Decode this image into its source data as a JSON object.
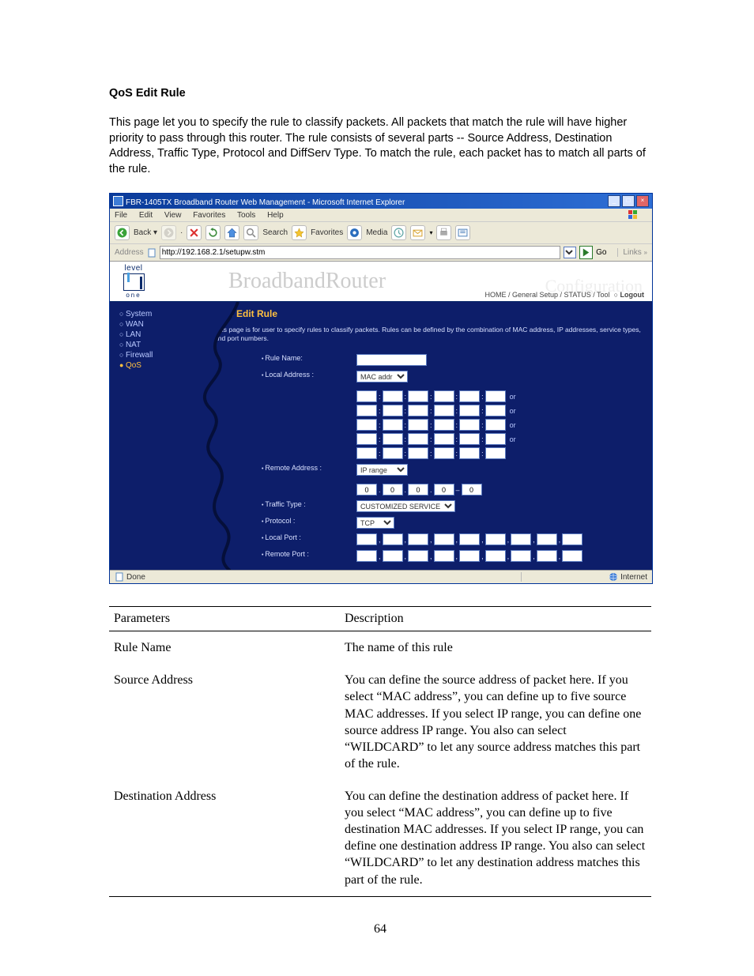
{
  "doc": {
    "heading": "QoS Edit Rule",
    "intro": "This page let you to specify the rule to classify packets. All packets that match the rule will have higher priority to pass through this router. The rule consists of several parts -- Source Address, Destination Address, Traffic Type, Protocol and DiffServ Type. To match the rule, each packet has to match all parts of the rule.",
    "page_num": "64"
  },
  "browser": {
    "title": "FBR-1405TX Broadband Router Web Management - Microsoft Internet Explorer",
    "menus": [
      "File",
      "Edit",
      "View",
      "Favorites",
      "Tools",
      "Help"
    ],
    "toolbar": {
      "back": "Back",
      "search": "Search",
      "favorites": "Favorites",
      "media": "Media"
    },
    "addr_label": "Address",
    "addr_value": "http://192.168.2.1/setupw.stm",
    "go": "Go",
    "links_label": "Links",
    "status": "Done",
    "zone": "Internet"
  },
  "page": {
    "logo_top": "level",
    "logo_bottom": "one",
    "big_title": "BroadbandRouter",
    "subtitle": "Configuration",
    "nav": {
      "home": "HOME",
      "gs": "General Setup",
      "status": "STATUS",
      "tool": "Tool",
      "logout": "Logout"
    },
    "sidebar": [
      {
        "label": "System",
        "active": false
      },
      {
        "label": "WAN",
        "active": false
      },
      {
        "label": "LAN",
        "active": false
      },
      {
        "label": "NAT",
        "active": false
      },
      {
        "label": "Firewall",
        "active": false
      },
      {
        "label": "QoS",
        "active": true
      }
    ],
    "form_title": "QoS Edit Rule",
    "form_desc": "This page is for user to specify rules to classify packets. Rules can be defined by the combination of MAC address, IP addresses, service types, and port numbers.",
    "labels": {
      "rule_name": "Rule Name:",
      "local_addr": "Local Address :",
      "remote_addr": "Remote Address :",
      "traffic_type": "Traffic Type :",
      "protocol": "Protocol :",
      "local_port": "Local Port :",
      "remote_port": "Remote Port :"
    },
    "local_addr_sel": "MAC addr",
    "remote_addr_sel": "IP range",
    "traffic_sel": "CUSTOMIZED SERVICE",
    "protocol_sel": "TCP",
    "or": "or",
    "ip_default": "0",
    "dash": "–"
  },
  "table": {
    "headers": {
      "param": "Parameters",
      "desc": "Description"
    },
    "rows": [
      {
        "p": "Rule Name",
        "d": "The name of this rule"
      },
      {
        "p": "Source Address",
        "d": "You can define the source address of packet here. If you select “MAC address”, you can define up to five source MAC addresses. If you select IP range, you can define one source address IP range. You also can select “WILDCARD” to let any source address matches this part of the rule."
      },
      {
        "p": "Destination Address",
        "d": "You can define the destination address of packet here. If you select “MAC address”, you can define up to five destination MAC addresses. If you select IP range, you can define one destination address IP range. You also can select “WILDCARD” to let any destination address matches this part of the rule."
      }
    ]
  }
}
